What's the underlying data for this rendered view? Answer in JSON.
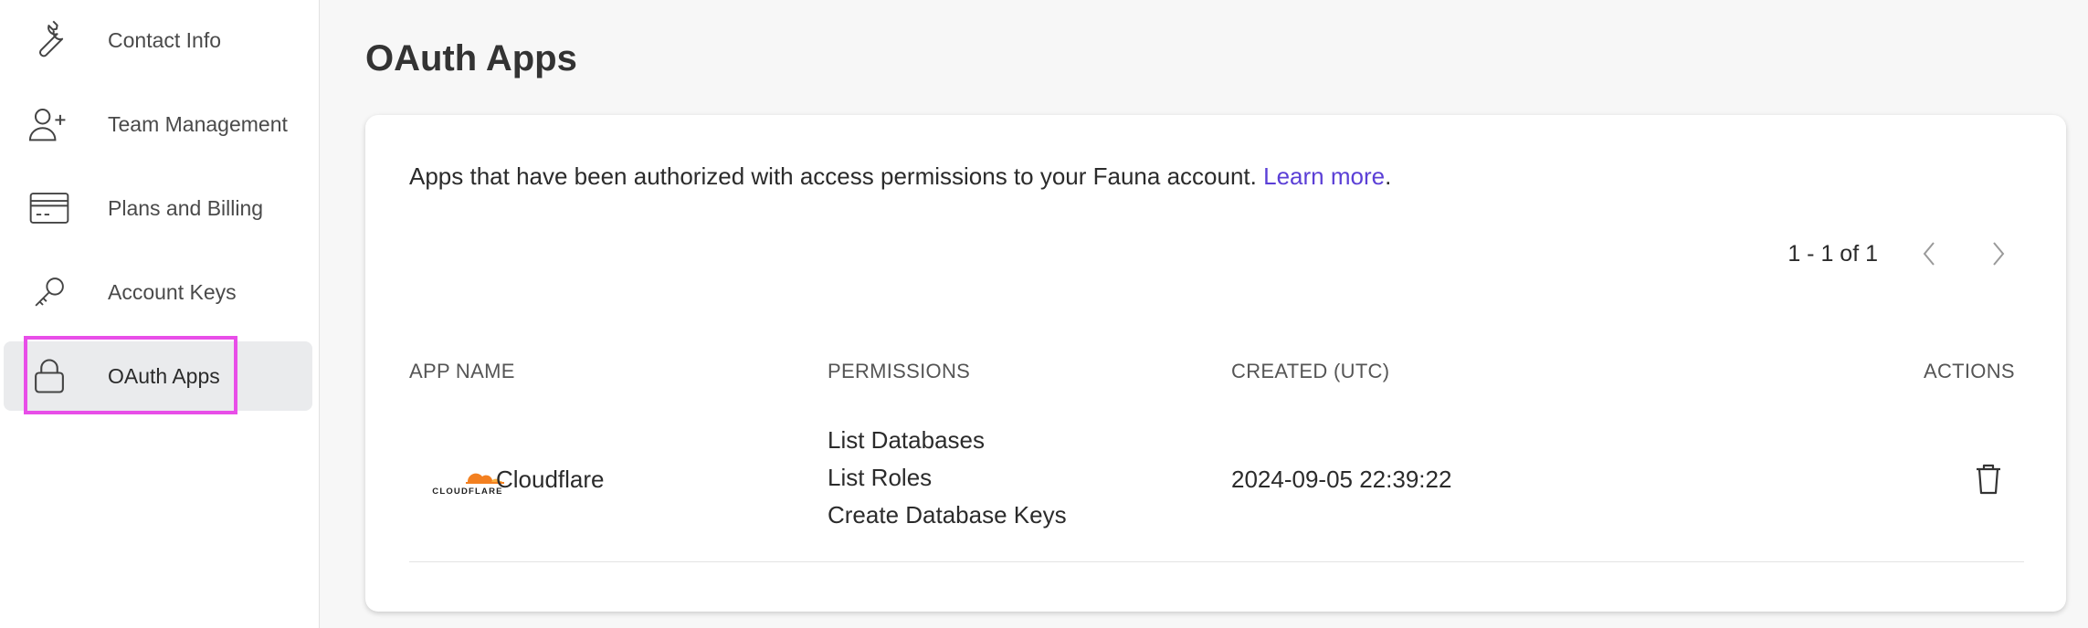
{
  "sidebar": {
    "items": [
      {
        "label": "Contact Info",
        "icon": "wrench-icon"
      },
      {
        "label": "Team Management",
        "icon": "add-user-icon"
      },
      {
        "label": "Plans and Billing",
        "icon": "credit-card-icon"
      },
      {
        "label": "Account Keys",
        "icon": "key-icon"
      },
      {
        "label": "OAuth Apps",
        "icon": "lock-icon",
        "active": true
      }
    ]
  },
  "main": {
    "title": "OAuth Apps",
    "description": "Apps that have been authorized with access permissions to your Fauna account.",
    "learn_more": "Learn more",
    "period": ".",
    "pagination": {
      "range": "1 - 1 of 1"
    },
    "table": {
      "headers": [
        "APP NAME",
        "PERMISSIONS",
        "CREATED (UTC)",
        "ACTIONS"
      ],
      "rows": [
        {
          "logo_text": "CLOUDFLARE",
          "app_name": "Cloudflare",
          "permissions": [
            "List Databases",
            "List Roles",
            "Create Database Keys"
          ],
          "created": "2024-09-05 22:39:22"
        }
      ]
    }
  },
  "colors": {
    "link": "#5b3fd6",
    "highlight": "#e84ee8",
    "cloudflare_orange": "#f38020"
  }
}
